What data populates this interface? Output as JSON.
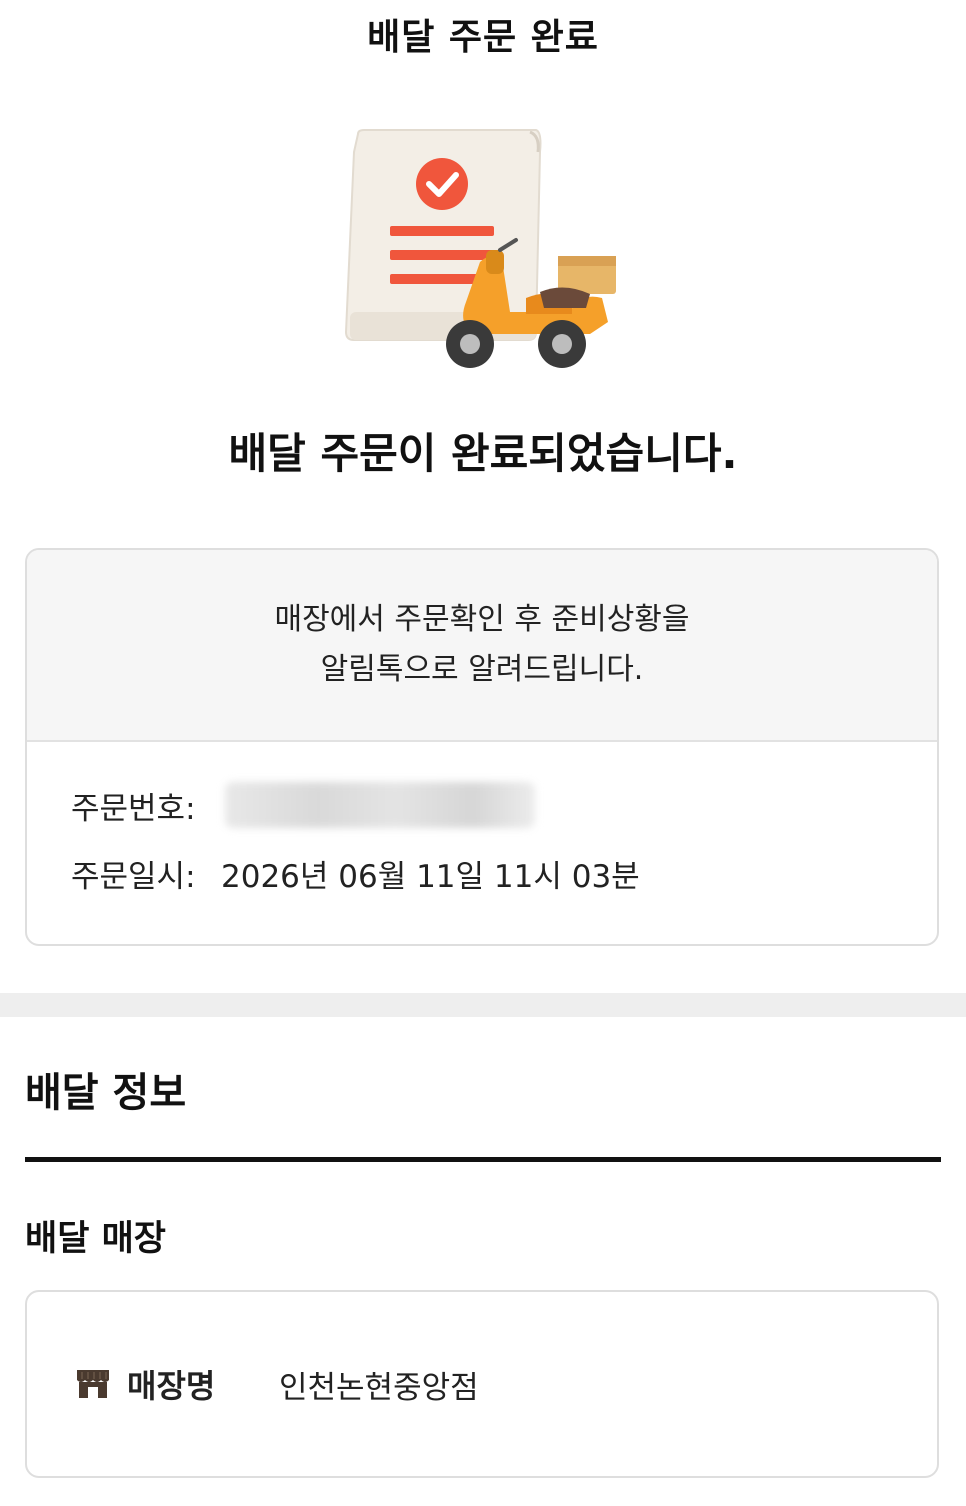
{
  "header": {
    "title": "배달 주문 완료"
  },
  "hero": {
    "headline": "배달 주문이 완료되었습니다."
  },
  "notice": {
    "line1": "매장에서 주문확인 후 준비상황을",
    "line2": "알림톡으로 알려드립니다."
  },
  "order": {
    "number_label": "주문번호:",
    "datetime_label": "주문일시:",
    "datetime_value": "2026년 06월 11일 11시 03분"
  },
  "delivery_info": {
    "title": "배달 정보",
    "store_section_title": "배달 매장",
    "store_label": "매장명",
    "store_name": "인천논현중앙점",
    "store_icon": "store-icon"
  },
  "colors": {
    "accent": "#f0563c",
    "scooter": "#f5a02a",
    "store_icon": "#4a3a2f"
  }
}
